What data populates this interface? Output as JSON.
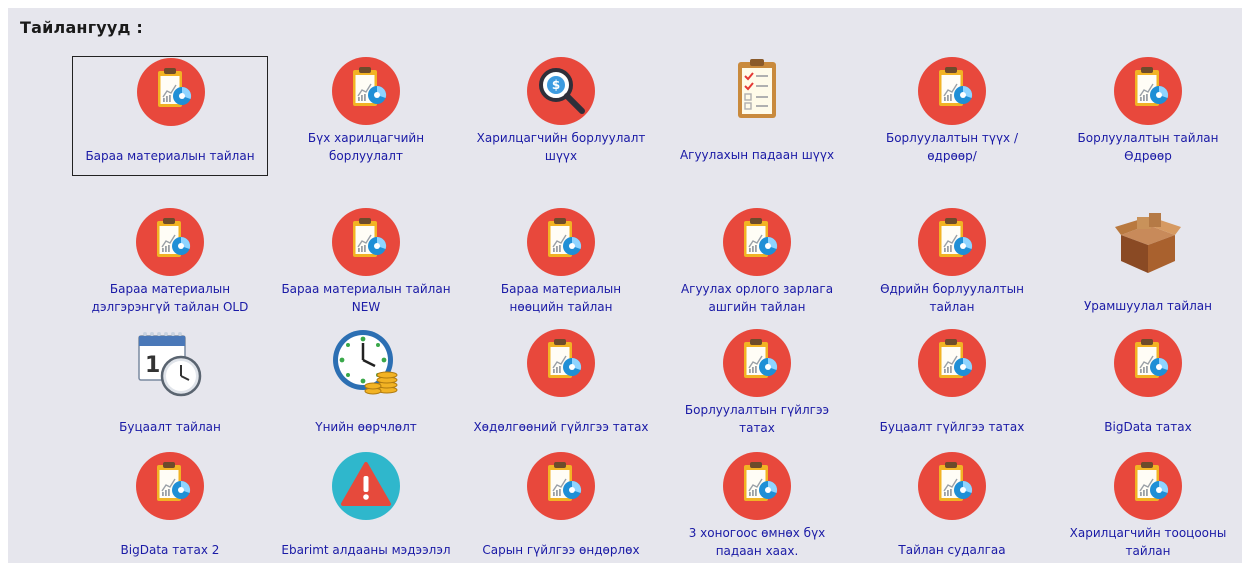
{
  "section_title": "Тайлангууд :",
  "tiles": [
    {
      "label_1": "Бараа материалын тайлан",
      "label_2": "",
      "icon": "report-clipboard-icon"
    },
    {
      "label_1": "Бүх харилцагчийн",
      "label_2": "борлуулалт",
      "icon": "report-clipboard-icon"
    },
    {
      "label_1": "Харилцагчийн борлуулалт",
      "label_2": "шүүх",
      "icon": "search-money-icon"
    },
    {
      "label_1": "Агуулахын падаан шүүх",
      "label_2": "",
      "icon": "checklist-clipboard-icon"
    },
    {
      "label_1": "Борлуулалтын түүх /",
      "label_2": "өдрөөр/",
      "icon": "report-clipboard-icon"
    },
    {
      "label_1": "Борлуулалтын тайлан",
      "label_2": "Өдрөөр",
      "icon": "report-clipboard-icon"
    },
    {
      "label_1": "Бараа материалын",
      "label_2": "дэлгэрэнгүй тайлан OLD",
      "icon": "report-clipboard-icon"
    },
    {
      "label_1": "Бараа материалын тайлан",
      "label_2": "NEW",
      "icon": "report-clipboard-icon"
    },
    {
      "label_1": "Бараа материалын",
      "label_2": "нөөцийн тайлан",
      "icon": "report-clipboard-icon"
    },
    {
      "label_1": "Агуулах орлого зарлага",
      "label_2": "ашгийн тайлан",
      "icon": "report-clipboard-icon"
    },
    {
      "label_1": "Өдрийн борлуулалтын",
      "label_2": "тайлан",
      "icon": "report-clipboard-icon"
    },
    {
      "label_1": "Урамшуулал тайлан",
      "label_2": "",
      "icon": "open-box-icon"
    },
    {
      "label_1": "Буцаалт тайлан",
      "label_2": "",
      "icon": "calendar-clock-icon"
    },
    {
      "label_1": "Үнийн өөрчлөлт",
      "label_2": "",
      "icon": "clock-coins-icon"
    },
    {
      "label_1": "Хөдөлгөөний гүйлгээ татах",
      "label_2": "",
      "icon": "report-clipboard-icon"
    },
    {
      "label_1": "Борлуулалтын гүйлгээ",
      "label_2": "татах",
      "icon": "report-clipboard-icon"
    },
    {
      "label_1": "Буцаалт гүйлгээ татах",
      "label_2": "",
      "icon": "report-clipboard-icon"
    },
    {
      "label_1": "BigData татах",
      "label_2": "",
      "icon": "report-clipboard-icon"
    },
    {
      "label_1": "BigData татах 2",
      "label_2": "",
      "icon": "report-clipboard-icon"
    },
    {
      "label_1": "Ebarimt алдааны мэдээлэл",
      "label_2": "",
      "icon": "warning-triangle-icon"
    },
    {
      "label_1": "Сарын гүйлгээ өндөрлөх",
      "label_2": "",
      "icon": "report-clipboard-icon"
    },
    {
      "label_1": "3 хоногоос өмнөх бүх",
      "label_2": "падаан хаах.",
      "icon": "report-clipboard-icon"
    },
    {
      "label_1": "Тайлан судалгаа",
      "label_2": "",
      "icon": "report-clipboard-icon"
    },
    {
      "label_1": "Харилцагчийн тооцооны",
      "label_2": "тайлан",
      "icon": "report-clipboard-icon"
    }
  ],
  "colors": {
    "panel_bg": "#e6e6ed",
    "link": "#1a1aa6",
    "icon_red": "#e8483c",
    "clipboard": "#f2b324"
  }
}
